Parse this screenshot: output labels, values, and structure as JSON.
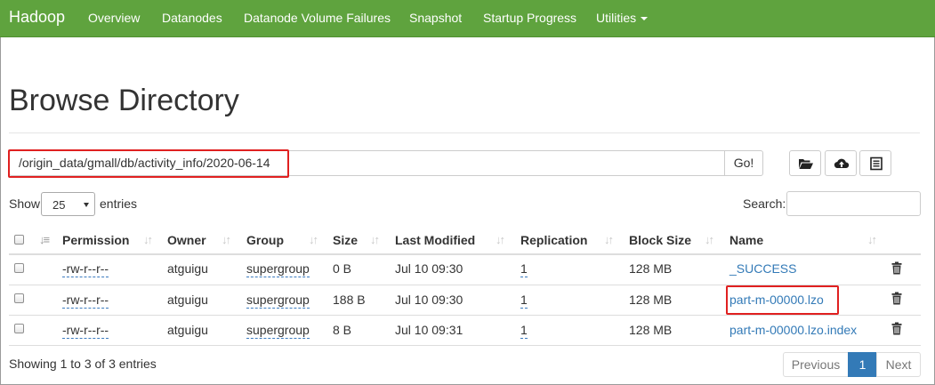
{
  "navbar": {
    "brand": "Hadoop",
    "items": [
      "Overview",
      "Datanodes",
      "Datanode Volume Failures",
      "Snapshot",
      "Startup Progress",
      "Utilities"
    ]
  },
  "page": {
    "title": "Browse Directory"
  },
  "path_bar": {
    "value": "/origin_data/gmall/db/activity_info/2020-06-14",
    "go_label": "Go!"
  },
  "toolbar_icons": [
    "folder-open-icon",
    "cloud-upload-icon",
    "list-alt-icon"
  ],
  "length": {
    "show_label": "Show",
    "value": "25",
    "entries_label": "entries"
  },
  "search": {
    "label": "Search:",
    "value": ""
  },
  "table": {
    "columns": [
      "Permission",
      "Owner",
      "Group",
      "Size",
      "Last Modified",
      "Replication",
      "Block Size",
      "Name"
    ],
    "rows": [
      {
        "permission": "-rw-r--r--",
        "owner": "atguigu",
        "group": "supergroup",
        "size": "0 B",
        "modified": "Jul 10 09:30",
        "replication": "1",
        "block_size": "128 MB",
        "name": "_SUCCESS"
      },
      {
        "permission": "-rw-r--r--",
        "owner": "atguigu",
        "group": "supergroup",
        "size": "188 B",
        "modified": "Jul 10 09:30",
        "replication": "1",
        "block_size": "128 MB",
        "name": "part-m-00000.lzo"
      },
      {
        "permission": "-rw-r--r--",
        "owner": "atguigu",
        "group": "supergroup",
        "size": "8 B",
        "modified": "Jul 10 09:31",
        "replication": "1",
        "block_size": "128 MB",
        "name": "part-m-00000.lzo.index"
      }
    ]
  },
  "footer": {
    "info": "Showing 1 to 3 of 3 entries",
    "previous": "Previous",
    "page": "1",
    "next": "Next"
  },
  "colors": {
    "navbar": "#5fa33e",
    "link": "#337ab7",
    "highlight": "#e02020"
  }
}
